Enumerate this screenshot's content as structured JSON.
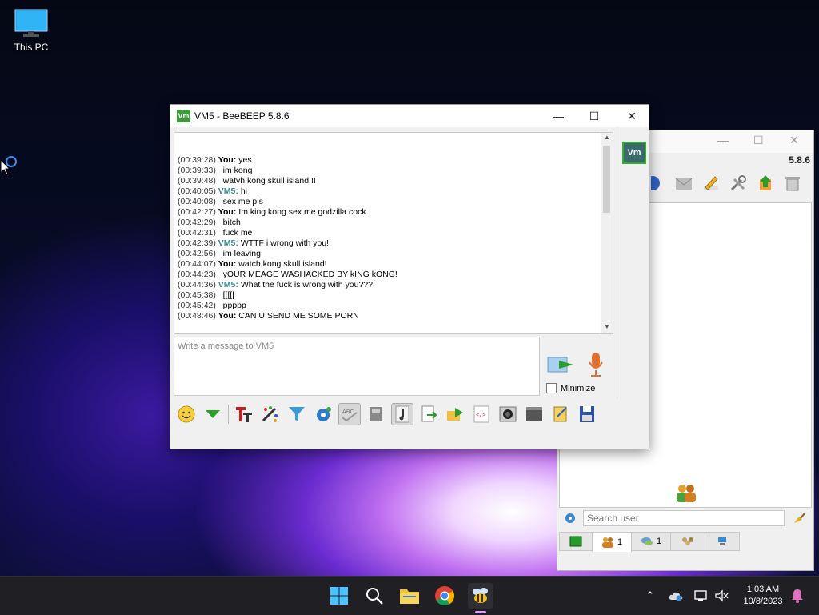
{
  "desktop": {
    "icon_label": "This PC"
  },
  "chat_window": {
    "title": "VM5 - BeeBEEP 5.8.6",
    "avatar_label": "Vm",
    "title_icon_label": "Vm",
    "input_placeholder": "Write a message to VM5",
    "minimize_label": "Minimize",
    "messages": [
      {
        "ts": "(00:39:28)",
        "sender": "You:",
        "text": "yes"
      },
      {
        "ts": "(00:39:33)",
        "sender": "",
        "text": "im kong"
      },
      {
        "ts": "(00:39:48)",
        "sender": "",
        "text": "watvh kong skull island!!!"
      },
      {
        "ts": "(00:40:05)",
        "sender": "VM5:",
        "text": "hi"
      },
      {
        "ts": "(00:40:08)",
        "sender": "",
        "text": "sex me pls"
      },
      {
        "ts": "(00:42:27)",
        "sender": "You:",
        "text": "Im king kong sex me godzilla cock"
      },
      {
        "ts": "(00:42:29)",
        "sender": "",
        "text": "bitch"
      },
      {
        "ts": "(00:42:31)",
        "sender": "",
        "text": "fuck me"
      },
      {
        "ts": "(00:42:39)",
        "sender": "VM5:",
        "text": "WTTF i wrong with you!"
      },
      {
        "ts": "(00:42:56)",
        "sender": "",
        "text": "im leaving"
      },
      {
        "ts": "(00:44:07)",
        "sender": "You:",
        "text": "watch kong skull island!"
      },
      {
        "ts": "(00:44:23)",
        "sender": "",
        "text": "yOUR MEAGE WASHACKED BY kING kONG!"
      },
      {
        "ts": "(00:44:36)",
        "sender": "VM5:",
        "text": "What the fuck is wrong with you???"
      },
      {
        "ts": "(00:45:38)",
        "sender": "",
        "text": "[[[[["
      },
      {
        "ts": "(00:45:42)",
        "sender": "",
        "text": "ppppp"
      },
      {
        "ts": "(00:48:46)",
        "sender": "You:",
        "text": "CAN U SEND ME SOME PORN"
      }
    ]
  },
  "main_window": {
    "version": "5.8.6",
    "search_placeholder": "Search user",
    "tabs": [
      {
        "icon": "users-icon",
        "count": "1"
      },
      {
        "icon": "chats-icon",
        "count": "1"
      },
      {
        "icon": "groups-icon",
        "count": ""
      },
      {
        "icon": "network-icon",
        "count": ""
      }
    ]
  },
  "taskbar": {
    "time": "1:03 AM",
    "date": "10/8/2023"
  },
  "colors": {
    "accent": "#2fb02f",
    "vm_sender": "#3a8a8a",
    "taskbar": "#1f1f24"
  }
}
